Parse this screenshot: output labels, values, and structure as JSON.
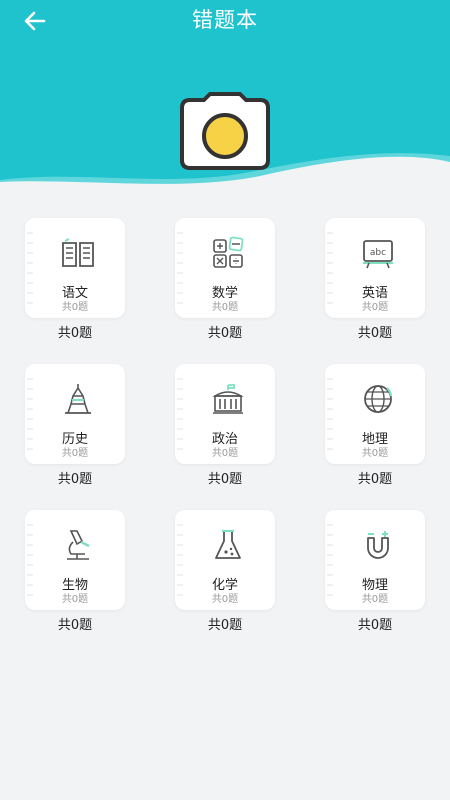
{
  "header": {
    "title": "错题本",
    "colors": {
      "primary": "#1ec3cd",
      "wave": "#5fd6dc",
      "camera_lens": "#f7d247"
    },
    "back_icon": "arrow-left-icon",
    "camera_icon": "camera-icon"
  },
  "subjects": [
    {
      "key": "chinese",
      "name": "语文",
      "sub": "共0题",
      "count": "共0题",
      "icon": "book-icon"
    },
    {
      "key": "math",
      "name": "数学",
      "sub": "共0题",
      "count": "共0题",
      "icon": "calculator-icon"
    },
    {
      "key": "english",
      "name": "英语",
      "sub": "共0题",
      "count": "共0题",
      "icon": "abc-board-icon"
    },
    {
      "key": "history",
      "name": "历史",
      "sub": "共0题",
      "count": "共0题",
      "icon": "tower-icon"
    },
    {
      "key": "politics",
      "name": "政治",
      "sub": "共0题",
      "count": "共0题",
      "icon": "building-icon"
    },
    {
      "key": "geography",
      "name": "地理",
      "sub": "共0题",
      "count": "共0题",
      "icon": "globe-icon"
    },
    {
      "key": "biology",
      "name": "生物",
      "sub": "共0题",
      "count": "共0题",
      "icon": "microscope-icon"
    },
    {
      "key": "chemistry",
      "name": "化学",
      "sub": "共0题",
      "count": "共0题",
      "icon": "flask-icon"
    },
    {
      "key": "physics",
      "name": "物理",
      "sub": "共0题",
      "count": "共0题",
      "icon": "magnet-icon"
    }
  ]
}
